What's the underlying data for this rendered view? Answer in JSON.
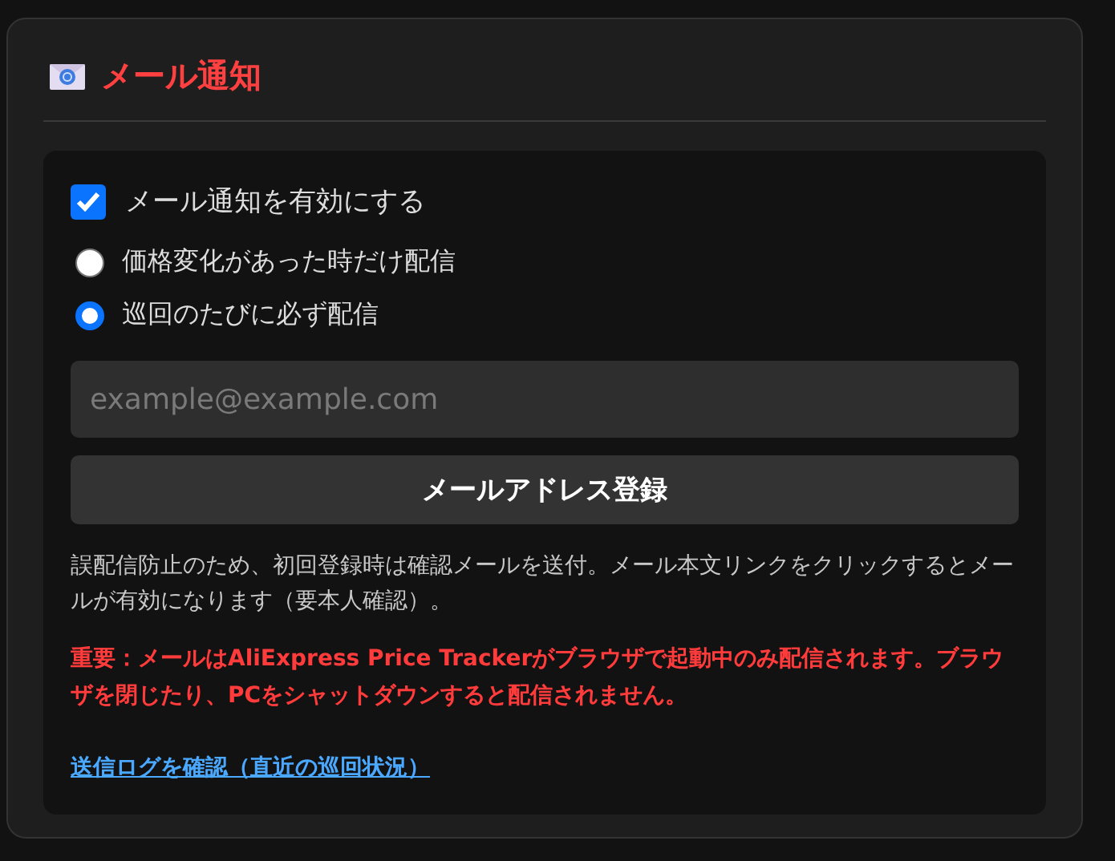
{
  "section": {
    "title": "メール通知"
  },
  "enable": {
    "label": "メール通知を有効にする",
    "checked": true
  },
  "delivery_options": [
    {
      "label": "価格変化があった時だけ配信",
      "selected": false
    },
    {
      "label": "巡回のたびに必ず配信",
      "selected": true
    }
  ],
  "email_field": {
    "placeholder": "example@example.com"
  },
  "register_button": "メールアドレス登録",
  "note": "誤配信防止のため、初回登録時は確認メールを送付。メール本文リンクをクリックするとメールが有効になります（要本人確認）。",
  "warning": "重要：メールはAliExpress Price Trackerがブラウザで起動中のみ配信されます。ブラウザを閉じたり、PCをシャットダウンすると配信されません。",
  "log_link": "送信ログを確認（直近の巡回状況）"
}
